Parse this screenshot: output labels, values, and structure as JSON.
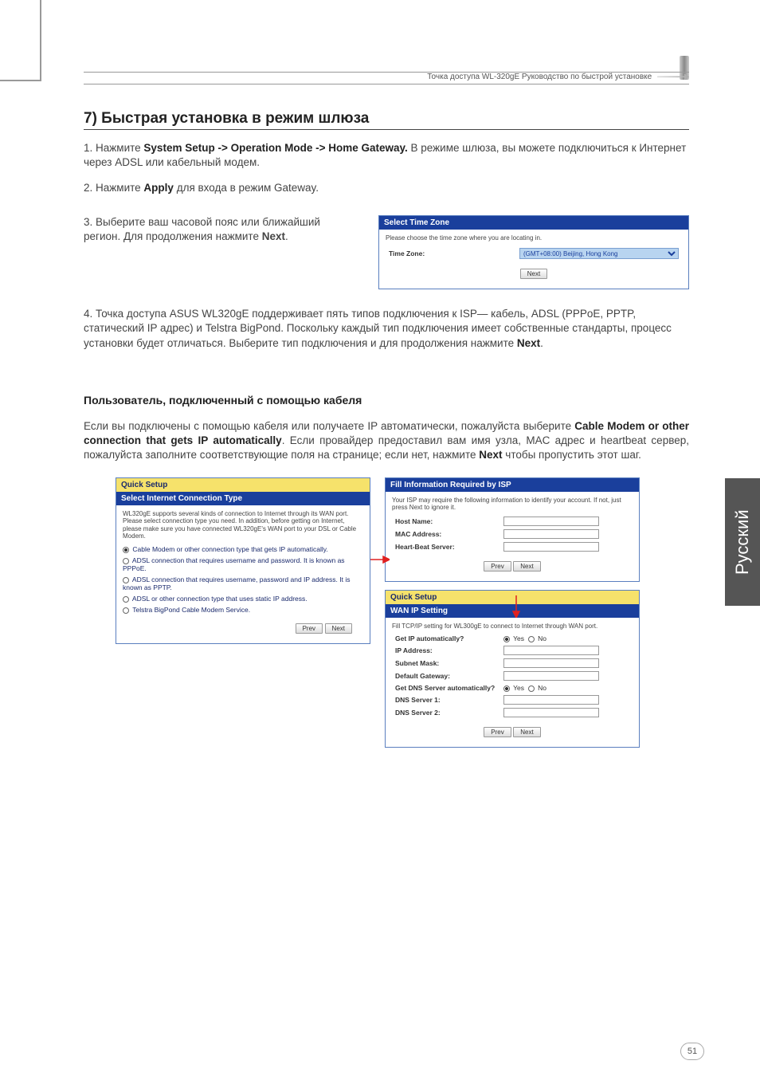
{
  "header": {
    "product_line": "Точка доступа WL-320gE Руководство по быстрой установке"
  },
  "section_title": "7) Быстрая установка в режим шлюза",
  "step1": {
    "pre": "1. Нажмите ",
    "bold": "System Setup -> Operation Mode -> Home Gateway.",
    "post": " В режиме шлюза, вы можете подключиться  к Интернет через ADSL или кабельный модем."
  },
  "step2": {
    "pre": "2. Нажмите ",
    "bold": "Apply",
    "post": " для входа в режим Gateway."
  },
  "step3": {
    "text_a": "3. Выберите ваш часовой пояс или ближайший регион. Для продолжения нажмите ",
    "bold": "Next",
    "text_b": "."
  },
  "step4": {
    "text_a": "4. Точка доступа ASUS WL320gE поддерживает пять типов подключения к ISP— кабель, ADSL (PPPoE, PPTP, статический IP адрес) и Telstra BigPond. Поскольку каждый тип подключения имеет собственные стандарты, процесс установки будет отличаться. Выберите тип подключения и для продолжения нажмите ",
    "bold": "Next",
    "text_b": "."
  },
  "sub_heading": "Пользователь, подключенный с помощью кабеля",
  "cable_para": {
    "a": "Если вы подключены с помощью кабеля или получаете IP автоматически, пожалуйста выберите ",
    "b": "Cable Modem or other connection that gets IP automatically",
    "c": ". Если провайдер предоставил вам имя узла, MAC адрес и heartbeat сервер, пожалуйста заполните соответствующие поля на странице; если нет, нажмите ",
    "d": "Next",
    "e": " чтобы пропустить этот шаг."
  },
  "side_tab": "Русский",
  "page_number": "51",
  "buttons": {
    "prev": "Prev",
    "next": "Next"
  },
  "panel_timezone": {
    "title": "Select Time Zone",
    "instruction": "Please choose the time zone where you are locating in.",
    "label": "Time Zone:",
    "value": "(GMT+08:00) Beijing, Hong Kong"
  },
  "panel_conn_type": {
    "title_yellow": "Quick Setup",
    "title_blue": "Select Internet Connection Type",
    "desc": "WL320gE supports several kinds of connection to Internet through its WAN port. Please select connection type you need. In addition, before getting on Internet, please make sure you have connected WL320gE's WAN port to your DSL or Cable Modem.",
    "options": [
      "Cable Modem or other connection type that gets IP automatically.",
      "ADSL connection that requires username and password. It is known as PPPoE.",
      "ADSL connection that requires username, password and IP address. It is known as PPTP.",
      "ADSL or other connection type that uses static IP address.",
      "Telstra BigPond Cable Modem Service."
    ]
  },
  "panel_isp": {
    "title": "Fill Information Required by ISP",
    "desc": "Your ISP may require the following information to identify your account. If not, just press Next to ignore it.",
    "fields": {
      "host_name": "Host Name:",
      "mac_address": "MAC Address:",
      "heartbeat": "Heart-Beat Server:"
    }
  },
  "panel_wan": {
    "title_yellow": "Quick Setup",
    "title_blue": "WAN IP Setting",
    "desc": "Fill TCP/IP setting for WL300gE to connect to Internet through WAN port.",
    "fields": {
      "get_ip": "Get IP automatically?",
      "ip_addr": "IP Address:",
      "subnet": "Subnet Mask:",
      "gateway": "Default Gateway:",
      "get_dns": "Get DNS Server automatically?",
      "dns1": "DNS Server 1:",
      "dns2": "DNS Server 2:"
    },
    "yes": "Yes",
    "no": "No"
  }
}
